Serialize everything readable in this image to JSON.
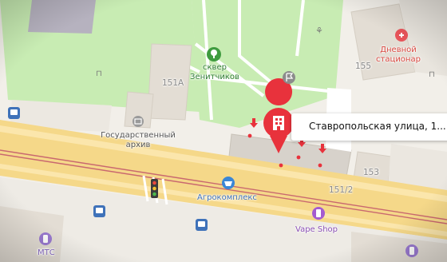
{
  "selected_place": {
    "label": "Ставропольская улица, 1..."
  },
  "labels": {
    "park": "сквер\nЗенитчиков",
    "building_151a": "151А",
    "archive": "Государственный\nархив",
    "agrocomplex": "Агрокомплекс",
    "vape_shop": "Vape Shop",
    "building_155": "155",
    "day_hospital": "Дневной\nстационар",
    "building_153": "153",
    "building_151_2": "151/2",
    "mts": "МТС"
  },
  "colors": {
    "selected_pin": "#e8323c",
    "park_green": "#b9e5a6",
    "road_yellow": "#f7d98a",
    "building": "#e3ddd4",
    "medical": "#e8545a",
    "shop_purple": "#a45bd0",
    "transport_blue": "#3f72b9"
  },
  "icons": {
    "park": "tree-icon",
    "archive": "archive-icon",
    "agrocomplex": "shopping-basket-icon",
    "vape_shop": "vape-icon",
    "hospital": "medical-cross-icon",
    "selected": "building-pin-icon",
    "bus": "bus-stop-icon",
    "traffic_light": "traffic-light-icon",
    "flag": "flag-icon",
    "mts": "mobile-operator-icon"
  }
}
